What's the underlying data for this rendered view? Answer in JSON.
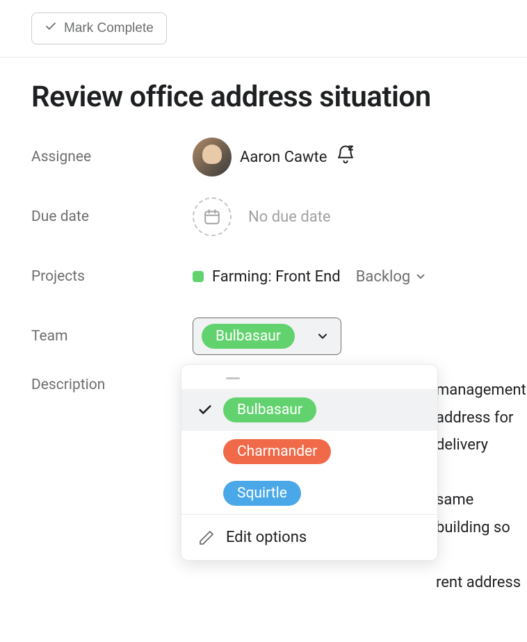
{
  "toolbar": {
    "mark_complete": "Mark Complete"
  },
  "task": {
    "title": "Review office address situation"
  },
  "fields": {
    "assignee_label": "Assignee",
    "assignee_name": "Aaron Cawte",
    "due_date_label": "Due date",
    "due_date_value": "No due date",
    "projects_label": "Projects",
    "project_name": "Farming: Front End",
    "project_section": "Backlog",
    "team_label": "Team",
    "team_value": "Bulbasaur",
    "description_label": "Description",
    "description_text": "management address for delivery\n\nsame building so\n\nrent address"
  },
  "dropdown": {
    "options": [
      {
        "label": "Bulbasaur",
        "color": "green",
        "selected": true
      },
      {
        "label": "Charmander",
        "color": "orange",
        "selected": false
      },
      {
        "label": "Squirtle",
        "color": "blue",
        "selected": false
      }
    ],
    "edit_label": "Edit options"
  }
}
